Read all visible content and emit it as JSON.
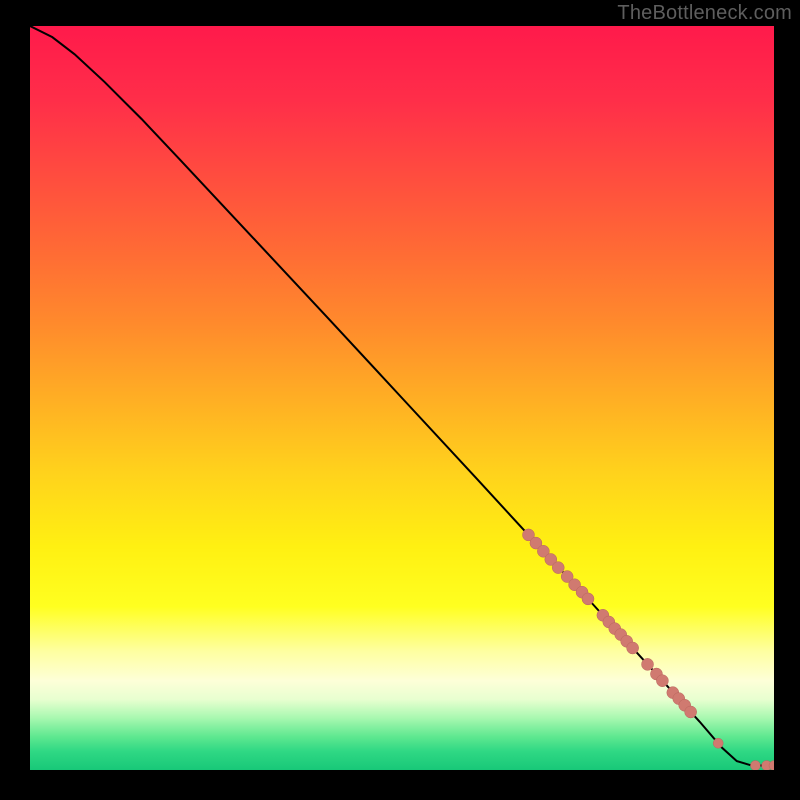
{
  "watermark": "TheBottleneck.com",
  "colors": {
    "gradient_stops": [
      {
        "offset": 0.0,
        "color": "#ff1a4b"
      },
      {
        "offset": 0.1,
        "color": "#ff2e49"
      },
      {
        "offset": 0.2,
        "color": "#ff4c3f"
      },
      {
        "offset": 0.3,
        "color": "#ff6a35"
      },
      {
        "offset": 0.4,
        "color": "#ff8a2c"
      },
      {
        "offset": 0.5,
        "color": "#ffae24"
      },
      {
        "offset": 0.6,
        "color": "#ffd21c"
      },
      {
        "offset": 0.7,
        "color": "#fff012"
      },
      {
        "offset": 0.78,
        "color": "#ffff20"
      },
      {
        "offset": 0.84,
        "color": "#feffa0"
      },
      {
        "offset": 0.88,
        "color": "#fdffd8"
      },
      {
        "offset": 0.905,
        "color": "#e8ffd0"
      },
      {
        "offset": 0.93,
        "color": "#a8f8b0"
      },
      {
        "offset": 0.955,
        "color": "#5fe890"
      },
      {
        "offset": 0.975,
        "color": "#2fd884"
      },
      {
        "offset": 1.0,
        "color": "#18c878"
      }
    ],
    "curve": "#000000",
    "marker_fill": "#d07a70",
    "marker_stroke": "#b8655c"
  },
  "chart_data": {
    "type": "line",
    "xlim": [
      0,
      100
    ],
    "ylim": [
      0,
      100
    ],
    "xlabel": "",
    "ylabel": "",
    "title": "",
    "curve": [
      {
        "x": 0,
        "y": 100
      },
      {
        "x": 3,
        "y": 98.5
      },
      {
        "x": 6,
        "y": 96.2
      },
      {
        "x": 10,
        "y": 92.5
      },
      {
        "x": 15,
        "y": 87.5
      },
      {
        "x": 20,
        "y": 82.2
      },
      {
        "x": 30,
        "y": 71.5
      },
      {
        "x": 40,
        "y": 60.8
      },
      {
        "x": 50,
        "y": 50.0
      },
      {
        "x": 60,
        "y": 39.2
      },
      {
        "x": 68,
        "y": 30.5
      },
      {
        "x": 75,
        "y": 23.0
      },
      {
        "x": 80,
        "y": 17.5
      },
      {
        "x": 85,
        "y": 12.0
      },
      {
        "x": 90,
        "y": 6.5
      },
      {
        "x": 93,
        "y": 3.0
      },
      {
        "x": 95,
        "y": 1.2
      },
      {
        "x": 97,
        "y": 0.6
      },
      {
        "x": 98.5,
        "y": 0.6
      },
      {
        "x": 100,
        "y": 0.6
      }
    ],
    "markers": [
      {
        "x": 67.0,
        "y": 31.6,
        "size": 6
      },
      {
        "x": 68.0,
        "y": 30.5,
        "size": 6
      },
      {
        "x": 69.0,
        "y": 29.4,
        "size": 6
      },
      {
        "x": 70.0,
        "y": 28.3,
        "size": 6
      },
      {
        "x": 71.0,
        "y": 27.2,
        "size": 6
      },
      {
        "x": 72.2,
        "y": 26.0,
        "size": 6
      },
      {
        "x": 73.2,
        "y": 24.9,
        "size": 6
      },
      {
        "x": 74.2,
        "y": 23.9,
        "size": 6
      },
      {
        "x": 75.0,
        "y": 23.0,
        "size": 6
      },
      {
        "x": 77.0,
        "y": 20.8,
        "size": 6
      },
      {
        "x": 77.8,
        "y": 19.9,
        "size": 6
      },
      {
        "x": 78.6,
        "y": 19.0,
        "size": 6
      },
      {
        "x": 79.4,
        "y": 18.2,
        "size": 6
      },
      {
        "x": 80.2,
        "y": 17.3,
        "size": 6
      },
      {
        "x": 81.0,
        "y": 16.4,
        "size": 6
      },
      {
        "x": 83.0,
        "y": 14.2,
        "size": 6
      },
      {
        "x": 84.2,
        "y": 12.9,
        "size": 6
      },
      {
        "x": 85.0,
        "y": 12.0,
        "size": 6
      },
      {
        "x": 86.4,
        "y": 10.4,
        "size": 6
      },
      {
        "x": 87.2,
        "y": 9.6,
        "size": 6
      },
      {
        "x": 88.0,
        "y": 8.7,
        "size": 6
      },
      {
        "x": 88.8,
        "y": 7.8,
        "size": 6
      },
      {
        "x": 92.5,
        "y": 3.6,
        "size": 5
      },
      {
        "x": 97.5,
        "y": 0.6,
        "size": 5
      },
      {
        "x": 99.0,
        "y": 0.6,
        "size": 5
      },
      {
        "x": 100.0,
        "y": 0.6,
        "size": 5
      }
    ]
  }
}
